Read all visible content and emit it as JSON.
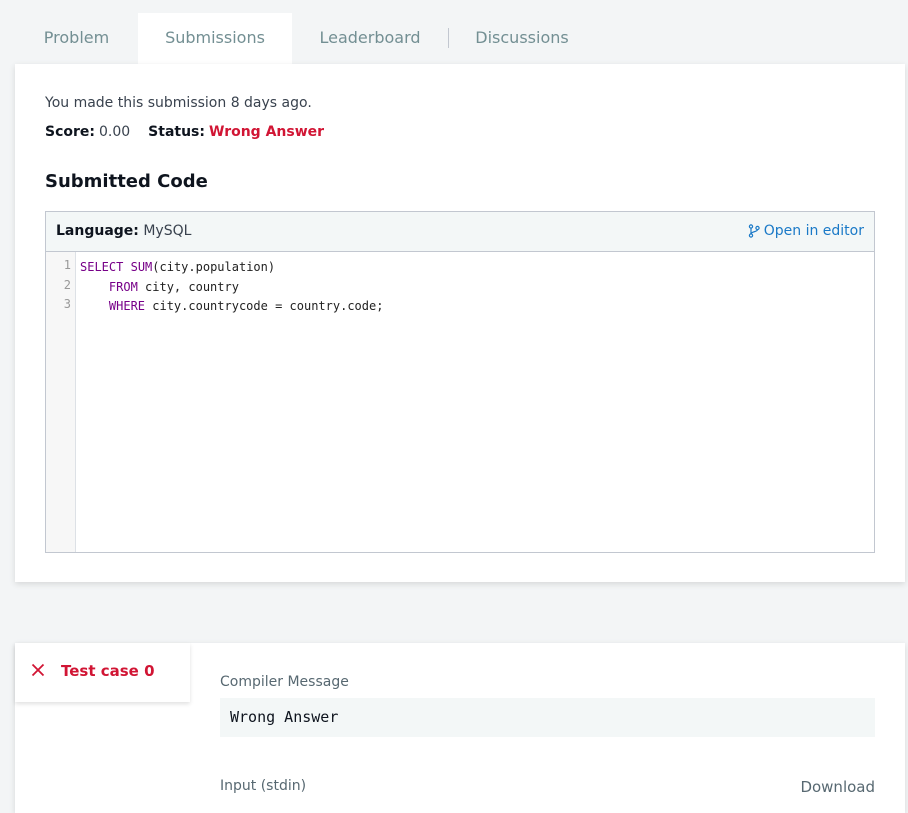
{
  "tabs": [
    {
      "label": "Problem"
    },
    {
      "label": "Submissions"
    },
    {
      "label": "Leaderboard"
    },
    {
      "label": "Discussions"
    }
  ],
  "submission": {
    "made_text": "You made this submission 8 days ago.",
    "score_label": "Score:",
    "score_value": "0.00",
    "status_label": "Status:",
    "status_value": "Wrong Answer",
    "status_color": "#d11534"
  },
  "code_section": {
    "title": "Submitted Code",
    "language_label": "Language:",
    "language_value": "MySQL",
    "open_editor_label": "Open in editor",
    "open_editor_icon": "branch-icon",
    "line_numbers": [
      "1",
      "2",
      "3"
    ],
    "lines": [
      "SELECT SUM(city.population)",
      "    FROM city, country",
      "    WHERE city.countrycode = country.code;"
    ]
  },
  "testcase": {
    "label": "Test case 0",
    "icon": "close-icon",
    "compiler_message_label": "Compiler Message",
    "compiler_message_value": "Wrong Answer",
    "input_label": "Input (stdin)",
    "download_label": "Download"
  }
}
